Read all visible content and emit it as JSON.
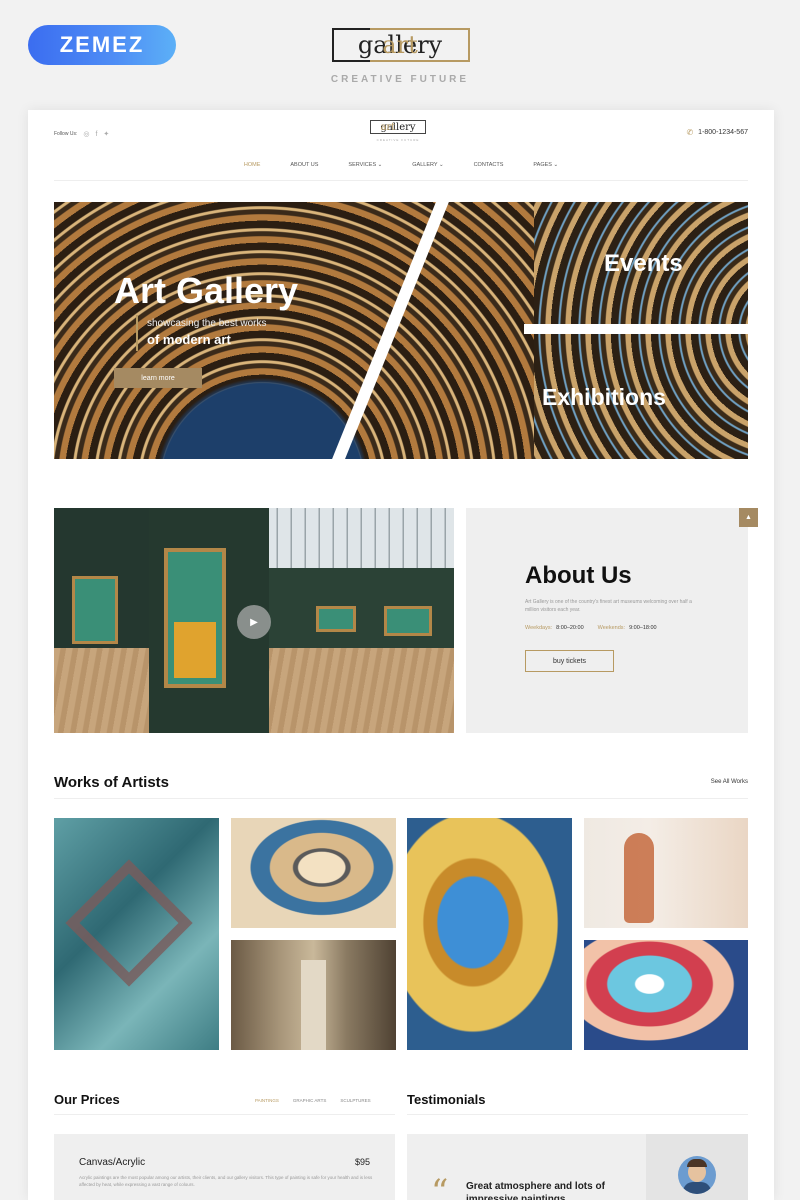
{
  "top": {
    "zemez_label": "ZEMEZ",
    "brand_art": "art",
    "brand_gallery": "gallery",
    "tagline": "CREATIVE FUTURE"
  },
  "header": {
    "follow_label": "Follow Us:",
    "brand_art": "art",
    "brand_gallery": "gallery",
    "brand_tagline": "CREATIVE FUTURE",
    "phone": "1-800-1234-567"
  },
  "nav": {
    "items": [
      "HOME",
      "ABOUT US",
      "SERVICES ⌄",
      "GALLERY ⌄",
      "CONTACTS",
      "PAGES ⌄"
    ]
  },
  "hero": {
    "title": "Art Gallery",
    "subtitle": "showcasing the best works",
    "subtitle2": "of modern art",
    "button": "learn more",
    "events": "Events",
    "exhibitions": "Exhibitions"
  },
  "about": {
    "title": "About Us",
    "text": "Art Gallery is one of the country's finest art museums welcoming over half a million visitors each year.",
    "weekdays_label": "Weekdays:",
    "weekdays_hours": "8:00–20:00",
    "weekends_label": "Weekends:",
    "weekends_hours": "9:00–18:00",
    "button": "buy tickets"
  },
  "works": {
    "title": "Works of Artists",
    "link": "See All Works"
  },
  "prices": {
    "title": "Our Prices",
    "tabs": [
      "PAINTINGS",
      "GRAPHIC ARTS",
      "SCULPTURES"
    ],
    "item_name": "Canvas/Acrylic",
    "item_price": "$95",
    "item_desc": "Acrylic paintings are the most popular among our artists, their clients, and our gallery visitors. This type of painting is safe for your health and is less affected by heat, while expressing a vast range of colours."
  },
  "testimonials": {
    "title": "Testimonials",
    "quote": "Great atmosphere and lots of impressive paintings"
  },
  "colors": {
    "accent": "#b79a62",
    "zemez_gradient_start": "#3b6df0",
    "zemez_gradient_end": "#5cb0f7"
  }
}
